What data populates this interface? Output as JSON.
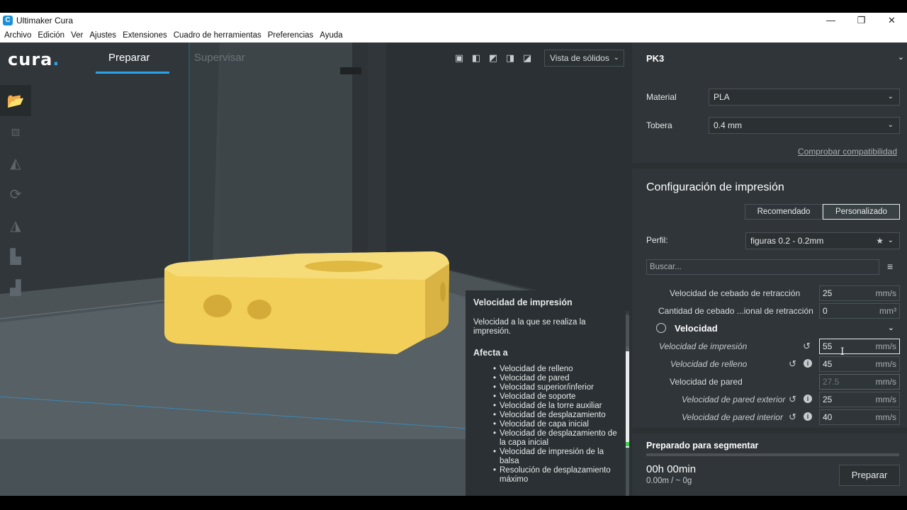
{
  "window": {
    "title": "Ultimaker Cura",
    "app_icon": "C",
    "controls": {
      "minimize": "—",
      "restore": "❐",
      "close": "✕"
    }
  },
  "menu": [
    "Archivo",
    "Edición",
    "Ver",
    "Ajustes",
    "Extensiones",
    "Cuadro de herramientas",
    "Preferencias",
    "Ayuda"
  ],
  "header": {
    "logo_text": "cura",
    "logo_dot": ".",
    "tabs": [
      {
        "label": "Preparar",
        "active": true
      },
      {
        "label": "Supervisar",
        "active": false
      }
    ],
    "view_mode": "Vista de sólidos",
    "view_icons": [
      "3d-view-icon",
      "front-view-icon",
      "top-view-icon",
      "left-view-icon",
      "right-view-icon"
    ]
  },
  "left_tools": [
    "open-file-icon",
    "move-icon",
    "scale-icon",
    "rotate-icon",
    "mirror-icon",
    "per-model-settings-icon",
    "support-blocker-icon"
  ],
  "tooltip": {
    "title": "Velocidad de impresión",
    "description": "Velocidad a la que se realiza la impresión.",
    "affects_title": "Afecta a",
    "affects": [
      "Velocidad de relleno",
      "Velocidad de pared",
      "Velocidad superior/inferior",
      "Velocidad de soporte",
      "Velocidad de la torre auxiliar",
      "Velocidad de desplazamiento",
      "Velocidad de capa inicial",
      "Velocidad de desplazamiento de la capa inicial",
      "Velocidad de impresión de la balsa",
      "Resolución de desplazamiento máximo"
    ]
  },
  "printer": {
    "name": "PK3",
    "material_label": "Material",
    "material_value": "PLA",
    "nozzle_label": "Tobera",
    "nozzle_value": "0.4 mm",
    "compat_link": "Comprobar compatibilidad"
  },
  "print_settings": {
    "title": "Configuración de impresión",
    "mode_recommended": "Recomendado",
    "mode_custom": "Personalizado",
    "profile_label": "Perfil:",
    "profile_value": "figuras 0.2 - 0.2mm",
    "search_placeholder": "Buscar...",
    "rows": [
      {
        "label": "Velocidad de cebado de retracción",
        "value": "25",
        "unit": "mm/s"
      },
      {
        "label": "Cantidad de cebado ...ional de retracción",
        "value": "0",
        "unit": "mm³"
      }
    ],
    "category": "Velocidad",
    "speed_rows": [
      {
        "label": "Velocidad de impresión",
        "value": "55",
        "unit": "mm/s"
      },
      {
        "label": "Velocidad de relleno",
        "value": "45",
        "unit": "mm/s"
      },
      {
        "label": "Velocidad de pared",
        "value": "27.5",
        "unit": "mm/s"
      },
      {
        "label": "Velocidad de pared exterior",
        "value": "25",
        "unit": "mm/s"
      },
      {
        "label": "Velocidad de pared interior",
        "value": "40",
        "unit": "mm/s"
      }
    ]
  },
  "slice": {
    "status": "Preparado para segmentar",
    "time": "00h 00min",
    "usage": "0.00m / ~ 0g",
    "button": "Preparar"
  },
  "colors": {
    "accent": "#2aa3e8",
    "model": "#f2cf58",
    "panel": "#2f3539",
    "background": "#2b3033"
  }
}
